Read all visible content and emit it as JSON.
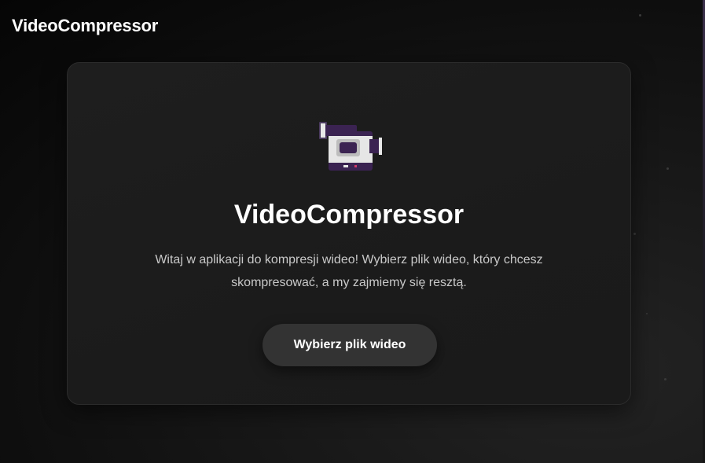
{
  "header": {
    "app_title": "VideoCompressor"
  },
  "card": {
    "icon": "video-camera-icon",
    "title": "VideoCompressor",
    "description_line1": "Witaj w aplikacji do kompresji wideo! Wybierz plik wideo, który chcesz",
    "description_line2": "skompresować, a my zajmiemy się resztą.",
    "button_label": "Wybierz plik wideo"
  },
  "colors": {
    "accent_purple": "#3b2352",
    "button_bg": "#333333",
    "card_bg": "#1c1c1c"
  }
}
